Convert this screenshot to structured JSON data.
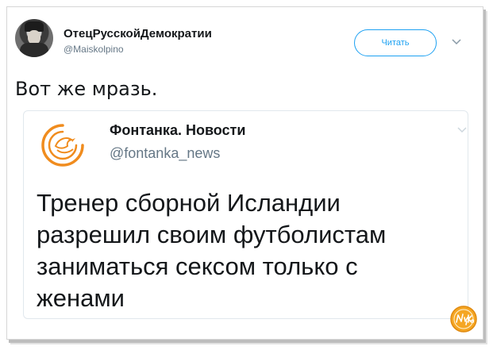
{
  "tweet": {
    "author": {
      "display_name": "ОтецРусскойДемократии",
      "handle": "@Maiskolpino",
      "avatar_icon": "user-avatar-photo"
    },
    "follow_label": "Читать",
    "menu_icon": "chevron-down-icon",
    "text": "Вот же мразь."
  },
  "quoted_tweet": {
    "author": {
      "display_name": "Фонтанка. Новости",
      "handle": "@fontanka_news",
      "avatar_icon": "fontanka-bird-logo"
    },
    "menu_icon": "chevron-down-icon",
    "text": "Тренер сборной Исландии разрешил своим футболистам заниматься сексом только с женами"
  },
  "watermark": {
    "text": "Nyka",
    "color": "#f5a623"
  },
  "colors": {
    "accent": "#1da1f2",
    "secondary_text": "#657786",
    "logo_orange": "#f08c1e"
  }
}
